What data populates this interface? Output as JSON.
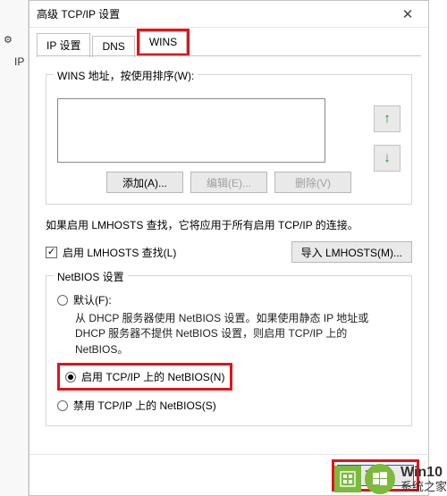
{
  "window": {
    "title": "高级 TCP/IP 设置",
    "close_glyph": "✕"
  },
  "left_panel": {
    "gear_glyph": "⚙",
    "label": "IP"
  },
  "tabs": {
    "ip": "IP 设置",
    "dns": "DNS",
    "wins": "WINS"
  },
  "wins_group": {
    "legend": "WINS 地址，按使用排序(W):",
    "up_glyph": "↑",
    "down_glyph": "↓",
    "add": "添加(A)...",
    "edit": "编辑(E)...",
    "remove": "删除(V)"
  },
  "lmhosts": {
    "note": "如果启用 LMHOSTS 查找，它将应用于所有启用 TCP/IP 的连接。",
    "checkbox_label": "启用 LMHOSTS 查找(L)",
    "check_glyph": "✓",
    "import_btn": "导入 LMHOSTS(M)..."
  },
  "netbios": {
    "legend": "NetBIOS 设置",
    "default_label": "默认(F):",
    "default_desc": "从 DHCP 服务器使用 NetBIOS 设置。如果使用静态 IP 地址或 DHCP 服务器不提供 NetBIOS 设置，则启用 TCP/IP 上的 NetBIOS。",
    "enable_label": "启用 TCP/IP 上的 NetBIOS(N)",
    "disable_label": "禁用 TCP/IP 上的 NetBIOS(S)"
  },
  "footer": {
    "ok": "确定"
  },
  "watermark": {
    "line1": "Win10",
    "line2": "系统之家"
  }
}
